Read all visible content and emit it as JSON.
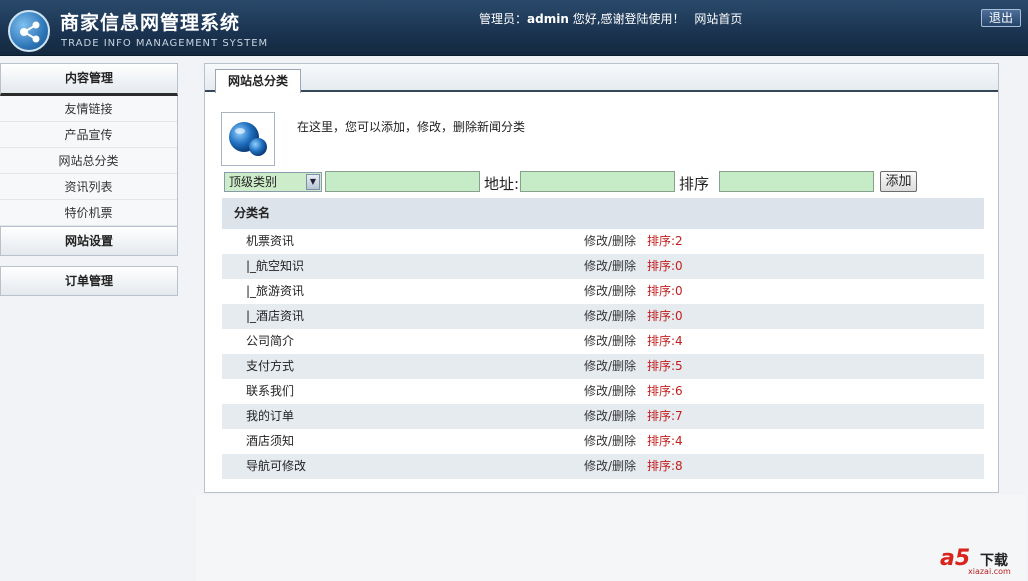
{
  "header": {
    "title_cn": "商家信息网管理系统",
    "title_en": "TRADE INFO MANAGEMENT SYSTEM",
    "welcome_prefix": "管理员：",
    "admin_name": "admin",
    "welcome_suffix": " 您好,感谢登陆使用！",
    "home_link": "网站首页",
    "logout_label": "退出"
  },
  "sidebar": {
    "sections": [
      {
        "label": "内容管理"
      },
      {
        "label": "网站设置"
      },
      {
        "label": "订单管理"
      }
    ],
    "items": [
      {
        "label": "友情链接"
      },
      {
        "label": "产品宣传"
      },
      {
        "label": "网站总分类"
      },
      {
        "label": "资讯列表"
      },
      {
        "label": "特价机票"
      }
    ]
  },
  "main": {
    "tab_label": "网站总分类",
    "intro_text": "在这里，您可以添加，修改，删除新闻分类",
    "form": {
      "select_value": "顶级类别",
      "address_label": "地址:",
      "sort_label": "排序",
      "add_label": "添加"
    },
    "table": {
      "header": "分类名",
      "rows": [
        {
          "name": "机票资讯",
          "ops": "修改/删除",
          "sort": "排序:2"
        },
        {
          "name": "|_航空知识",
          "ops": "修改/删除",
          "sort": "排序:0"
        },
        {
          "name": "|_旅游资讯",
          "ops": "修改/删除",
          "sort": "排序:0"
        },
        {
          "name": "|_酒店资讯",
          "ops": "修改/删除",
          "sort": "排序:0"
        },
        {
          "name": "公司简介",
          "ops": "修改/删除",
          "sort": "排序:4"
        },
        {
          "name": "支付方式",
          "ops": "修改/删除",
          "sort": "排序:5"
        },
        {
          "name": "联系我们",
          "ops": "修改/删除",
          "sort": "排序:6"
        },
        {
          "name": "我的订单",
          "ops": "修改/删除",
          "sort": "排序:7"
        },
        {
          "name": "酒店须知",
          "ops": "修改/删除",
          "sort": "排序:4"
        },
        {
          "name": "导航可修改",
          "ops": "修改/删除",
          "sort": "排序:8"
        }
      ]
    }
  },
  "watermark": {
    "brand": "a5",
    "download": "下载",
    "site": "xiazai.com"
  }
}
